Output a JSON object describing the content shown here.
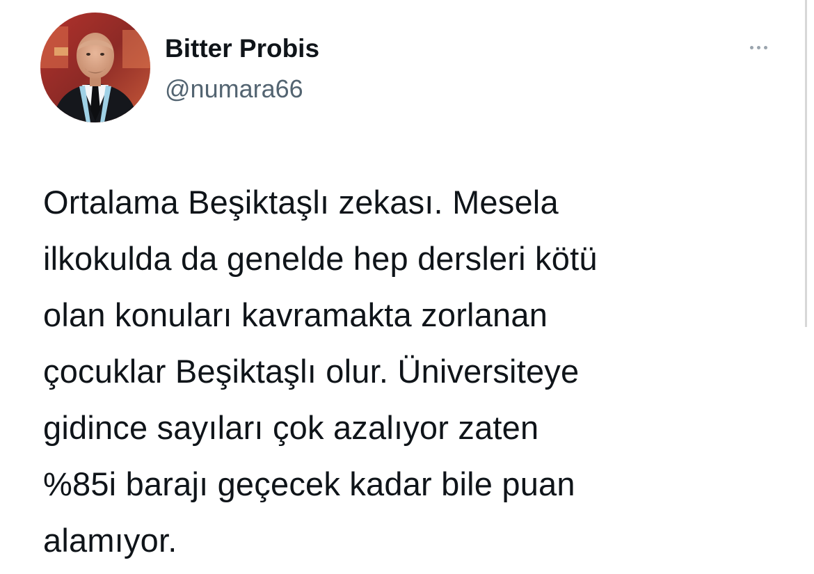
{
  "author": {
    "display_name": "Bitter Probis",
    "handle": "@numara66",
    "avatar_icon": "profile-photo"
  },
  "more_icon": "more-horizontal-icon",
  "tweet": {
    "lines": [
      "Ortalama Beşiktaşlı zekası. Mesela",
      "ilkokulda da genelde hep dersleri kötü",
      "olan konuları kavramakta zorlanan",
      "çocuklar Beşiktaşlı olur. Üniversiteye",
      "gidince sayıları çok azalıyor zaten",
      "%85i barajı geçecek kadar bile puan",
      "alamıyor."
    ]
  },
  "colors": {
    "text_primary": "#0f1419",
    "text_secondary": "#536471",
    "background": "#ffffff"
  }
}
